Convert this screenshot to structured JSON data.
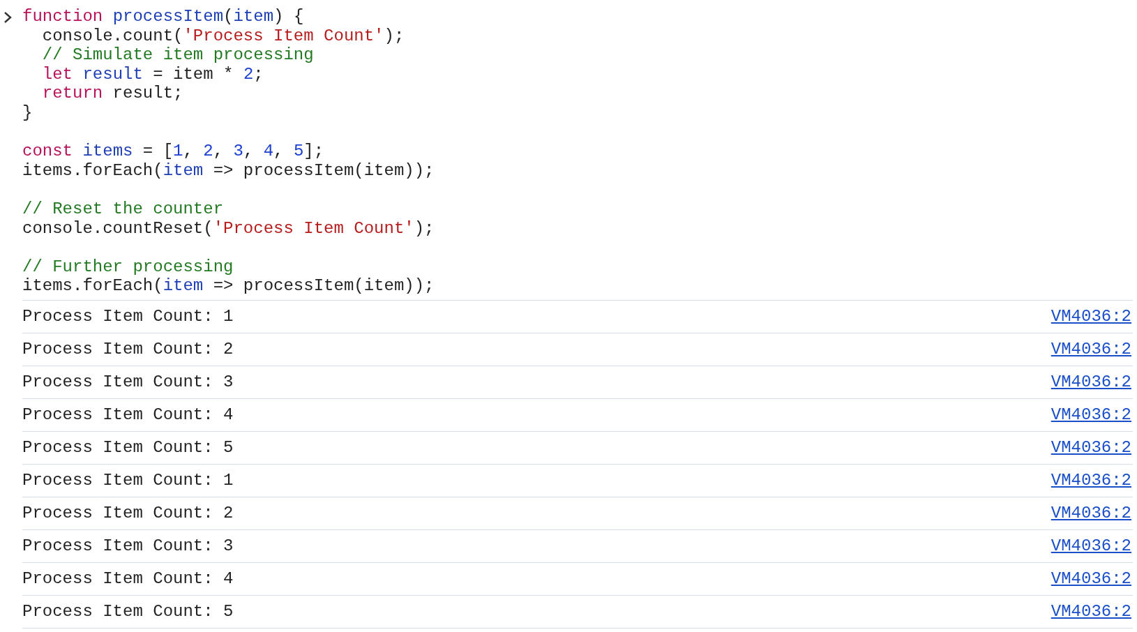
{
  "input": {
    "code_blocks": [
      [
        [
          {
            "kind": "keyword",
            "text": "function "
          },
          {
            "kind": "def",
            "text": "processItem"
          },
          {
            "kind": "plain",
            "text": "("
          },
          {
            "kind": "def",
            "text": "item"
          },
          {
            "kind": "plain",
            "text": ") {"
          }
        ],
        [
          {
            "kind": "plain",
            "text": "  console.count("
          },
          {
            "kind": "string",
            "text": "'Process Item Count'"
          },
          {
            "kind": "plain",
            "text": ");"
          }
        ],
        [
          {
            "kind": "comment",
            "text": "  // Simulate item processing"
          }
        ],
        [
          {
            "kind": "keyword",
            "text": "  let "
          },
          {
            "kind": "def",
            "text": "result"
          },
          {
            "kind": "plain",
            "text": " = item * "
          },
          {
            "kind": "number",
            "text": "2"
          },
          {
            "kind": "plain",
            "text": ";"
          }
        ],
        [
          {
            "kind": "keyword",
            "text": "  return"
          },
          {
            "kind": "plain",
            "text": " result;"
          }
        ],
        [
          {
            "kind": "plain",
            "text": "}"
          }
        ]
      ],
      [
        [
          {
            "kind": "keyword",
            "text": "const "
          },
          {
            "kind": "def",
            "text": "items"
          },
          {
            "kind": "plain",
            "text": " = ["
          },
          {
            "kind": "number",
            "text": "1"
          },
          {
            "kind": "plain",
            "text": ", "
          },
          {
            "kind": "number",
            "text": "2"
          },
          {
            "kind": "plain",
            "text": ", "
          },
          {
            "kind": "number",
            "text": "3"
          },
          {
            "kind": "plain",
            "text": ", "
          },
          {
            "kind": "number",
            "text": "4"
          },
          {
            "kind": "plain",
            "text": ", "
          },
          {
            "kind": "number",
            "text": "5"
          },
          {
            "kind": "plain",
            "text": "];"
          }
        ],
        [
          {
            "kind": "plain",
            "text": "items.forEach("
          },
          {
            "kind": "def",
            "text": "item"
          },
          {
            "kind": "plain",
            "text": " => processItem(item));"
          }
        ]
      ],
      [
        [
          {
            "kind": "comment",
            "text": "// Reset the counter"
          }
        ],
        [
          {
            "kind": "plain",
            "text": "console.countReset("
          },
          {
            "kind": "string",
            "text": "'Process Item Count'"
          },
          {
            "kind": "plain",
            "text": ");"
          }
        ]
      ],
      [
        [
          {
            "kind": "comment",
            "text": "// Further processing"
          }
        ],
        [
          {
            "kind": "plain",
            "text": "items.forEach("
          },
          {
            "kind": "def",
            "text": "item"
          },
          {
            "kind": "plain",
            "text": " => processItem(item));"
          }
        ]
      ]
    ]
  },
  "log": [
    {
      "message": "Process Item Count: 1",
      "source": "VM4036:2"
    },
    {
      "message": "Process Item Count: 2",
      "source": "VM4036:2"
    },
    {
      "message": "Process Item Count: 3",
      "source": "VM4036:2"
    },
    {
      "message": "Process Item Count: 4",
      "source": "VM4036:2"
    },
    {
      "message": "Process Item Count: 5",
      "source": "VM4036:2"
    },
    {
      "message": "Process Item Count: 1",
      "source": "VM4036:2"
    },
    {
      "message": "Process Item Count: 2",
      "source": "VM4036:2"
    },
    {
      "message": "Process Item Count: 3",
      "source": "VM4036:2"
    },
    {
      "message": "Process Item Count: 4",
      "source": "VM4036:2"
    },
    {
      "message": "Process Item Count: 5",
      "source": "VM4036:2"
    }
  ]
}
